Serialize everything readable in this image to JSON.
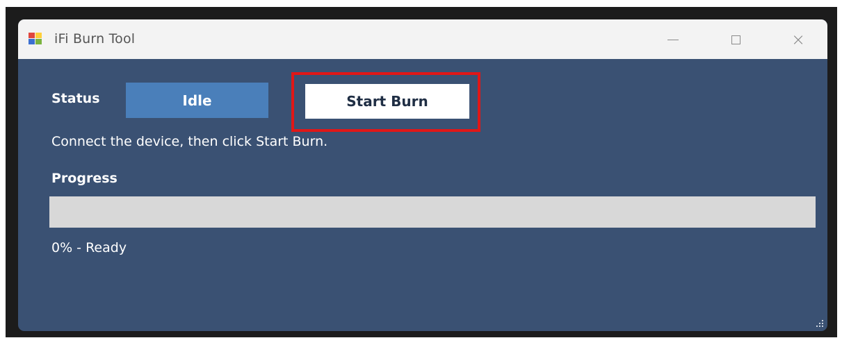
{
  "window": {
    "title": "iFi Burn Tool",
    "icon": "app-icon"
  },
  "title_controls": {
    "minimize": "minimize-icon",
    "maximize": "maximize-icon",
    "close": "close-icon",
    "close_glyph": "×"
  },
  "status": {
    "label": "Status",
    "value": "Idle"
  },
  "actions": {
    "start_burn_label": "Start Burn"
  },
  "instruction": "Connect the device, then click Start Burn.",
  "progress": {
    "label": "Progress",
    "percent": 0,
    "text": "0% - Ready"
  },
  "colors": {
    "window_bg": "#3a5173",
    "status_bg": "#4a7fba",
    "highlight": "#e01717",
    "progress_track": "#d8d8d8"
  }
}
